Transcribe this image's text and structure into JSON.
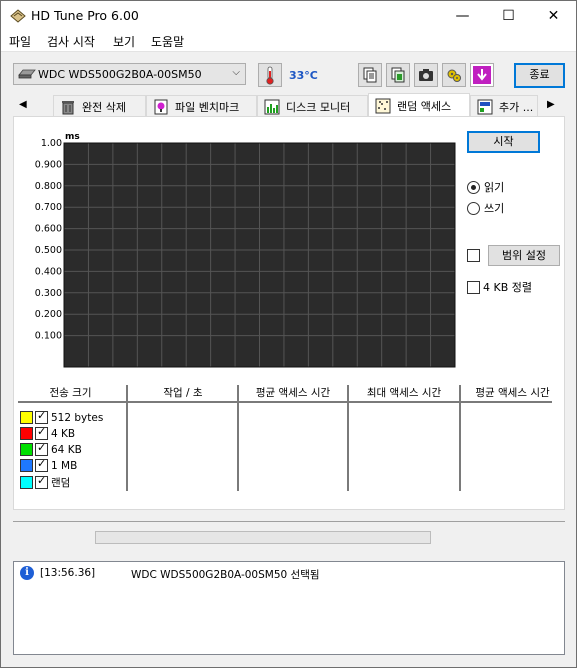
{
  "window": {
    "title": "HD Tune Pro 6.00",
    "minimize": "—",
    "maximize": "☐",
    "close": "✕"
  },
  "menu": [
    "파일",
    "검사 시작",
    "보기",
    "도움말"
  ],
  "toolbar": {
    "drive": "WDC  WDS500G2B0A-00SM50",
    "temperature": "33°C",
    "exit_label": "종료"
  },
  "tabs": {
    "items": [
      "완전 삭제",
      "파일 벤치마크",
      "디스크 모니터",
      "랜덤 액세스",
      "추가 ..."
    ],
    "active": "랜덤 액세스"
  },
  "chart_data": {
    "type": "scatter",
    "ylabel": "ms",
    "ylim": [
      0,
      1.0
    ],
    "yticks": [
      "1.00",
      "0.900",
      "0.800",
      "0.700",
      "0.600",
      "0.500",
      "0.400",
      "0.300",
      "0.200",
      "0.100"
    ],
    "series": [],
    "grid": true
  },
  "controls": {
    "start_label": "시작",
    "read_label": "읽기",
    "write_label": "쓰기",
    "read_selected": true,
    "range_label": "범위 설정",
    "range_checked": false,
    "align_label": "4 KB 정렬",
    "align_checked": false
  },
  "table": {
    "headers": [
      "전송 크기",
      "작업 / 초",
      "평균 액세스 시간",
      "최대 액세스 시간",
      "평균 액세스 시간"
    ],
    "rows": [
      {
        "label": "512 bytes",
        "color": "#ffff00"
      },
      {
        "label": "4 KB",
        "color": "#ff0000"
      },
      {
        "label": "64 KB",
        "color": "#00e000"
      },
      {
        "label": "1 MB",
        "color": "#1e78ff"
      },
      {
        "label": "랜덤",
        "color": "#00ffff"
      }
    ]
  },
  "log": {
    "timestamp": "[13:56.36]",
    "message": "WDC  WDS500G2B0A-00SM50 선택됨"
  }
}
